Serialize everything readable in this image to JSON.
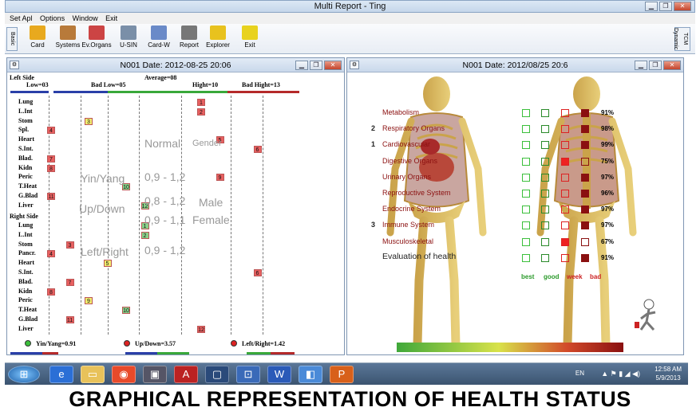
{
  "app": {
    "title": "Multi Report - Ting"
  },
  "menu": [
    "Set Apl",
    "Options",
    "Window",
    "Exit"
  ],
  "toolbar": {
    "left_tab": "Basic",
    "right_tab": "TCM Dynamic",
    "buttons": [
      {
        "label": "Card",
        "icon": "card-icon",
        "color": "#e8a91e"
      },
      {
        "label": "Systems",
        "icon": "people-icon",
        "color": "#b87a3a"
      },
      {
        "label": "Ev.Organs",
        "icon": "organs-icon",
        "color": "#c44"
      },
      {
        "label": "U-SIN",
        "icon": "u-sin-icon",
        "color": "#7a8fa8"
      },
      {
        "label": "Card-W",
        "icon": "card-w-icon",
        "color": "#6a8ac8"
      },
      {
        "label": "Report",
        "icon": "report-icon",
        "color": "#777"
      },
      {
        "label": "Explorer",
        "icon": "explorer-icon",
        "color": "#e8c21e"
      },
      {
        "label": "Exit",
        "icon": "exit-icon",
        "color": "#e8d21e"
      }
    ]
  },
  "left_window": {
    "title": "N001 Date: 2012-08-25 20:06",
    "header": {
      "left_side": "Left Side",
      "average": "Average=08",
      "low": "Low=03",
      "bad_low": "Bad Low=05",
      "hight": "Hight=10",
      "bad_hight": "Bad Hight=13"
    },
    "left_side_rows": [
      {
        "label": "Lung",
        "value": "1",
        "col": 9
      },
      {
        "label": "L.Int",
        "value": "2",
        "col": 9
      },
      {
        "label": "Stom",
        "value": "3",
        "col": 3
      },
      {
        "label": "Spl.",
        "value": "4",
        "col": 1
      },
      {
        "label": "Heart",
        "value": "5",
        "col": 10
      },
      {
        "label": "S.Int.",
        "value": "6",
        "col": 12
      },
      {
        "label": "Blad.",
        "value": "7",
        "col": 1
      },
      {
        "label": "Kidn",
        "value": "8",
        "col": 1
      },
      {
        "label": "Peric",
        "value": "9",
        "col": 10
      },
      {
        "label": "T.Heat",
        "value": "10",
        "col": 5
      },
      {
        "label": "G.Blad",
        "value": "11",
        "col": 1
      },
      {
        "label": "Liver",
        "value": "12",
        "col": 6
      }
    ],
    "right_side_label": "Right Side",
    "right_side_rows": [
      {
        "label": "Lung",
        "value": "1",
        "col": 6
      },
      {
        "label": "L.Int",
        "value": "2",
        "col": 6
      },
      {
        "label": "Stom",
        "value": "3",
        "col": 2
      },
      {
        "label": "Pancr.",
        "value": "4",
        "col": 1
      },
      {
        "label": "Heart",
        "value": "5",
        "col": 4
      },
      {
        "label": "S.Int.",
        "value": "6",
        "col": 12
      },
      {
        "label": "Blad.",
        "value": "7",
        "col": 2
      },
      {
        "label": "Kidn",
        "value": "8",
        "col": 1
      },
      {
        "label": "Peric",
        "value": "9",
        "col": 3
      },
      {
        "label": "T.Heat",
        "value": "10",
        "col": 5
      },
      {
        "label": "G.Blad",
        "value": "11",
        "col": 2
      },
      {
        "label": "Liver",
        "value": "12",
        "col": 9
      }
    ],
    "overlay": {
      "normal": "Normal",
      "gender": "Gender",
      "yin_yang": "Yin/Yang",
      "yy_range": "0,9 - 1,2",
      "up_down": "Up/Down",
      "ud_range": "0,8 - 1,2",
      "male": "Male",
      "female": "Female",
      "female_range": "0,9 - 1,1",
      "left_right": "Left/Right",
      "lr_range": "0,9 - 1,2"
    },
    "status": {
      "yin_yang": "Yin/Yang=0.91",
      "up_down": "Up/Down=3.57",
      "left_right": "Left/Right=1.42"
    },
    "colors": {
      "red": "#e86060",
      "yellow": "#f2ee70",
      "green": "#8ad28a"
    }
  },
  "right_window": {
    "title": "N001 Date: 2012/08/25 20:6",
    "systems": [
      {
        "name": "Metabolism",
        "num": "",
        "pct": "91%",
        "level": 3
      },
      {
        "name": "Respiratory Organs",
        "num": "2",
        "pct": "98%",
        "level": 3
      },
      {
        "name": "Cardiovascular",
        "num": "1",
        "pct": "99%",
        "level": 3
      },
      {
        "name": "Digestive Organs",
        "num": "",
        "pct": "75%",
        "level": 2
      },
      {
        "name": "Urinary Organs",
        "num": "",
        "pct": "97%",
        "level": 3
      },
      {
        "name": "Reproductive System",
        "num": "",
        "pct": "96%",
        "level": 3
      },
      {
        "name": "Endocrine System",
        "num": "",
        "pct": "97%",
        "level": 3
      },
      {
        "name": "Immune System",
        "num": "3",
        "pct": "97%",
        "level": 3
      },
      {
        "name": "Musculoskeletal",
        "num": "",
        "pct": "67%",
        "level": 2
      },
      {
        "name": "Evaluation of health",
        "num": "",
        "pct": "91%",
        "level": 3
      }
    ],
    "legend": [
      "best",
      "good",
      "week",
      "bad"
    ]
  },
  "taskbar": {
    "apps": [
      "ie-icon",
      "folder-icon",
      "chrome-icon",
      "app-icon",
      "access-icon",
      "window-icon",
      "network-icon",
      "word-icon",
      "control-panel-icon",
      "powerpoint-icon"
    ],
    "lang": "EN",
    "time": "12:58 AM",
    "date": "5/9/2013"
  },
  "caption": "GRAPHICAL REPRESENTATION OF HEALTH STATUS"
}
